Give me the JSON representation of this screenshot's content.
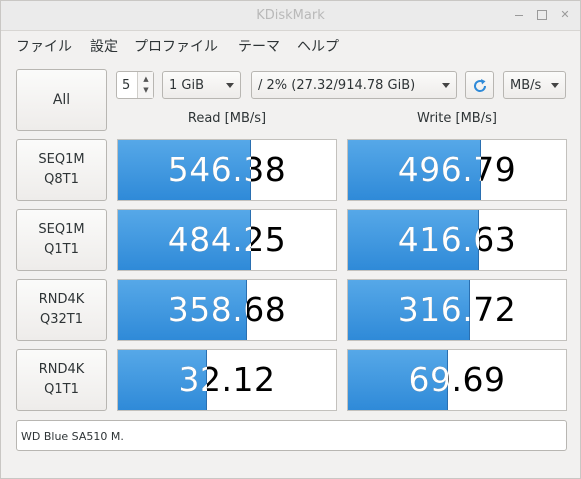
{
  "window": {
    "title": "KDiskMark"
  },
  "menu": [
    "ファイル",
    "設定",
    "プロファイル",
    "テーマ",
    "ヘルプ"
  ],
  "controls": {
    "all_label": "All",
    "runs": "5",
    "size": "1 GiB",
    "drive": "/ 2% (27.32/914.78 GiB)",
    "unit": "MB/s"
  },
  "headers": {
    "read": "Read [MB/s]",
    "write": "Write [MB/s]"
  },
  "tests": [
    {
      "line1": "SEQ1M",
      "line2": "Q8T1",
      "read": "546.38",
      "write": "496.79",
      "read_fill": 0.61,
      "write_fill": 0.61
    },
    {
      "line1": "SEQ1M",
      "line2": "Q1T1",
      "read": "484.25",
      "write": "416.63",
      "read_fill": 0.61,
      "write_fill": 0.6
    },
    {
      "line1": "RND4K",
      "line2": "Q32T1",
      "read": "358.68",
      "write": "316.72",
      "read_fill": 0.59,
      "write_fill": 0.56
    },
    {
      "line1": "RND4K",
      "line2": "Q1T1",
      "read": "32.12",
      "write": "69.69",
      "read_fill": 0.41,
      "write_fill": 0.46
    }
  ],
  "comment": "WD Blue SA510 M."
}
